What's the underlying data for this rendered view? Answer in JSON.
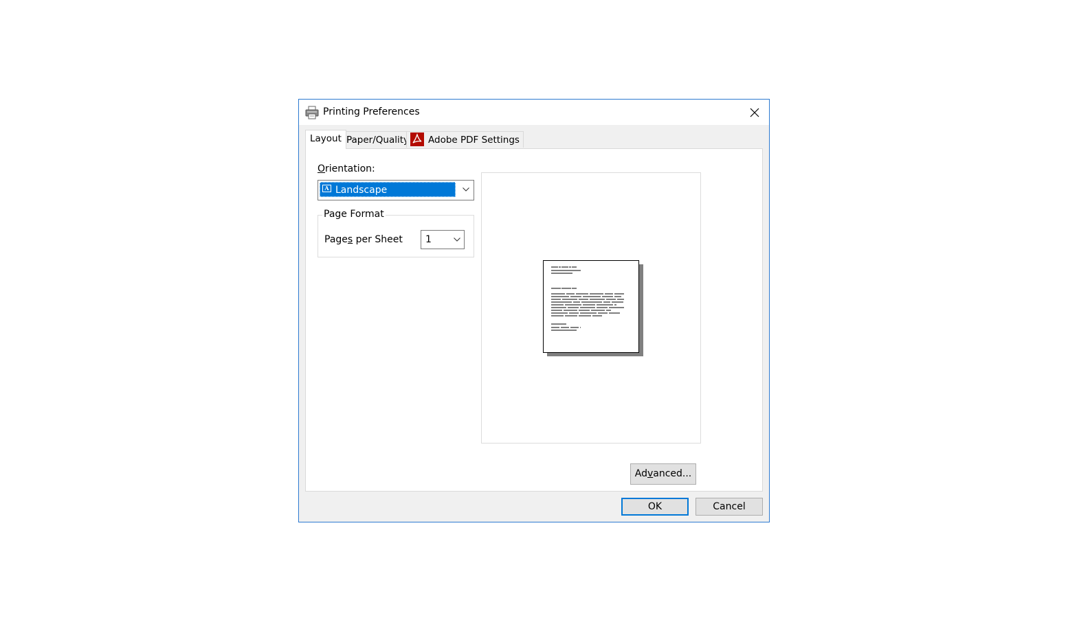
{
  "window": {
    "title": "Printing Preferences",
    "close_icon": "close-icon",
    "app_icon": "printer-icon"
  },
  "tabs": [
    {
      "label": "Layout",
      "active": true
    },
    {
      "label": "Paper/Quality",
      "active": false
    },
    {
      "label": "Adobe PDF Settings",
      "active": false,
      "icon": "adobe-acrobat-icon"
    }
  ],
  "layout": {
    "orientation_label_prefix": "",
    "orientation_label_mnemonic": "O",
    "orientation_label_rest": "rientation:",
    "orientation_value": "Landscape",
    "orientation_icon_letter": "A",
    "page_format": {
      "title": "Page Format",
      "pages_per_sheet_label_a": "Page",
      "pages_per_sheet_label_mnemonic": "s",
      "pages_per_sheet_label_b": " per Sheet",
      "pages_per_sheet_value": "1"
    },
    "advanced_label_a": "Ad",
    "advanced_label_mnemonic": "v",
    "advanced_label_b": "anced..."
  },
  "footer": {
    "ok_label": "OK",
    "cancel_label": "Cancel"
  },
  "colors": {
    "accent": "#0078d7",
    "window_border": "#2b79d0",
    "adobe_red": "#b30b00"
  }
}
